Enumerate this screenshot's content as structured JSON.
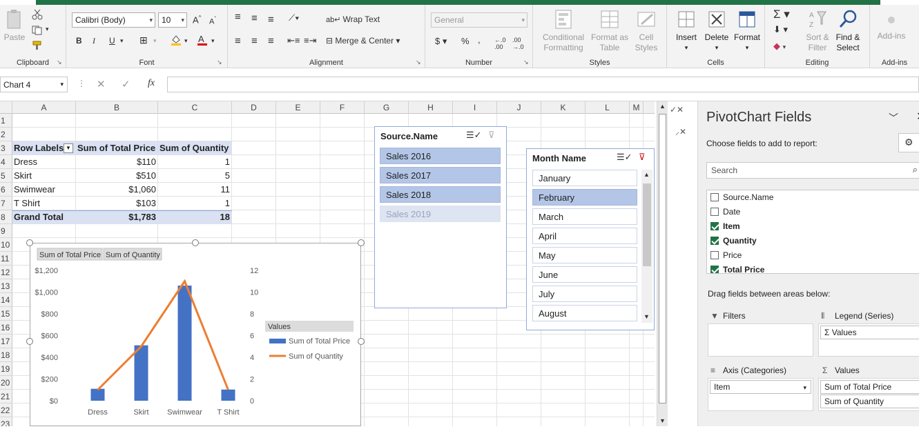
{
  "ribbon": {
    "clipboard": {
      "paste": "Paste",
      "label": "Clipboard"
    },
    "font": {
      "name": "Calibri (Body)",
      "size": "10",
      "label": "Font"
    },
    "alignment": {
      "wrap": "Wrap Text",
      "merge": "Merge & Center",
      "label": "Alignment"
    },
    "number": {
      "format": "General",
      "label": "Number"
    },
    "styles": {
      "conditional": "Conditional Formatting",
      "format_table": "Format as Table",
      "cell_styles": "Cell Styles",
      "label": "Styles"
    },
    "cells": {
      "insert": "Insert",
      "delete": "Delete",
      "format": "Format",
      "label": "Cells"
    },
    "editing": {
      "sort": "Sort & Filter",
      "find": "Find & Select",
      "label": "Editing"
    },
    "addins": {
      "btn": "Add-ins",
      "label": "Add-ins"
    }
  },
  "formula_bar": {
    "name_box": "Chart 4",
    "fx": "fx"
  },
  "columns": [
    "A",
    "B",
    "C",
    "D",
    "E",
    "F",
    "G",
    "H",
    "I",
    "J",
    "K",
    "L",
    "M"
  ],
  "rows": [
    "1",
    "2",
    "3",
    "4",
    "5",
    "6",
    "7",
    "8",
    "9",
    "10",
    "11",
    "12",
    "13",
    "14",
    "15",
    "16",
    "17",
    "18",
    "19",
    "20",
    "21",
    "22",
    "23"
  ],
  "pivot": {
    "headers": [
      "Row Labels",
      "Sum of Total Price",
      "Sum of Quantity"
    ],
    "rows": [
      [
        "Dress",
        "$110",
        "1"
      ],
      [
        "Skirt",
        "$510",
        "5"
      ],
      [
        "Swimwear",
        "$1,060",
        "11"
      ],
      [
        "T Shirt",
        "$103",
        "1"
      ]
    ],
    "total": [
      "Grand Total",
      "$1,783",
      "18"
    ]
  },
  "slicer_source": {
    "title": "Source.Name",
    "items": [
      {
        "label": "Sales 2016",
        "state": "selected"
      },
      {
        "label": "Sales 2017",
        "state": "selected"
      },
      {
        "label": "Sales 2018",
        "state": "selected"
      },
      {
        "label": "Sales 2019",
        "state": "nodata"
      }
    ]
  },
  "slicer_month": {
    "title": "Month Name",
    "items": [
      {
        "label": "January",
        "state": "normal"
      },
      {
        "label": "February",
        "state": "selected"
      },
      {
        "label": "March",
        "state": "normal"
      },
      {
        "label": "April",
        "state": "normal"
      },
      {
        "label": "May",
        "state": "normal"
      },
      {
        "label": "June",
        "state": "normal"
      },
      {
        "label": "July",
        "state": "normal"
      },
      {
        "label": "August",
        "state": "normal"
      }
    ]
  },
  "chart_data": {
    "type": "bar",
    "field_buttons": [
      "Sum of Total Price",
      "Sum of Quantity"
    ],
    "categories": [
      "Dress",
      "Skirt",
      "Swimwear",
      "T Shirt"
    ],
    "series": [
      {
        "name": "Sum of Total Price",
        "type": "bar",
        "axis": "left",
        "values": [
          110,
          510,
          1060,
          103
        ],
        "color": "#4472c4"
      },
      {
        "name": "Sum of Quantity",
        "type": "line",
        "axis": "right",
        "values": [
          1,
          5,
          11,
          1
        ],
        "color": "#ed7d31"
      }
    ],
    "y_left": {
      "min": 0,
      "max": 1200,
      "ticks": [
        "$0",
        "$200",
        "$400",
        "$600",
        "$800",
        "$1,000",
        "$1,200"
      ]
    },
    "y_right": {
      "min": 0,
      "max": 12,
      "ticks": [
        "0",
        "2",
        "4",
        "6",
        "8",
        "10",
        "12"
      ]
    },
    "legend_title": "Values",
    "legend_position": "right",
    "grid": false
  },
  "pane": {
    "title": "PivotChart Fields",
    "subtitle": "Choose fields to add to report:",
    "search_placeholder": "Search",
    "fields": [
      {
        "name": "Source.Name",
        "checked": false
      },
      {
        "name": "Date",
        "checked": false
      },
      {
        "name": "Item",
        "checked": true
      },
      {
        "name": "Quantity",
        "checked": true
      },
      {
        "name": "Price",
        "checked": false
      },
      {
        "name": "Total Price",
        "checked": true
      }
    ],
    "drag_text": "Drag fields between areas below:",
    "filters": "Filters",
    "legend": "Legend (Series)",
    "legend_item": "Values",
    "axis": "Axis (Categories)",
    "axis_item": "Item",
    "values": "Values",
    "values_items": [
      "Sum of Total Price",
      "Sum of Quantity"
    ]
  }
}
